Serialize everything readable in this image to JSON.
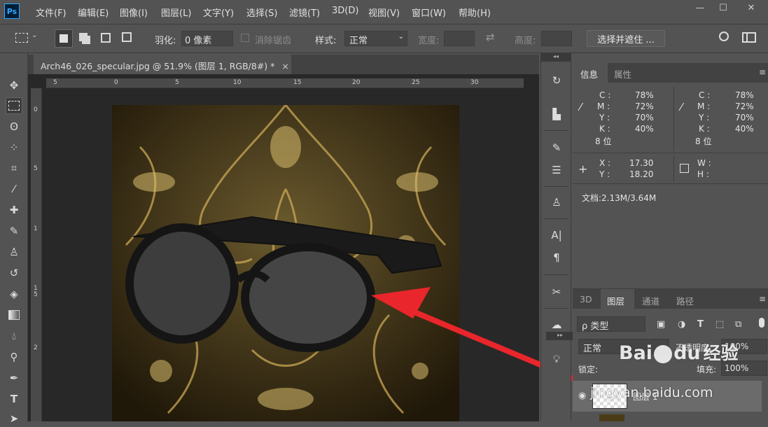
{
  "app": {
    "logo": "Ps"
  },
  "menu": [
    "文件(F)",
    "编辑(E)",
    "图像(I)",
    "图层(L)",
    "文字(Y)",
    "选择(S)",
    "滤镜(T)",
    "3D(D)",
    "视图(V)",
    "窗口(W)",
    "帮助(H)"
  ],
  "window_controls": [
    "—",
    "☐",
    "✕"
  ],
  "options": {
    "feather_label": "羽化:",
    "feather_value": "0 像素",
    "antialias_label": "消除锯齿",
    "style_label": "样式:",
    "style_value": "正常",
    "width_label": "宽度:",
    "height_label": "高度:",
    "select_mask_label": "选择并遮住 ..."
  },
  "document": {
    "tab_title": "Arch46_026_specular.jpg @ 51.9% (图层 1, RGB/8#) *",
    "close": "×",
    "ruler_top_labels": [
      "5",
      "0",
      "5",
      "10",
      "15",
      "20",
      "25",
      "30"
    ],
    "ruler_left_labels": [
      "0",
      "5",
      "1",
      "1\n5",
      "2"
    ]
  },
  "info_panel": {
    "tabs": [
      "信息",
      "属性"
    ],
    "c_label": "C :",
    "c_value": "78%",
    "m_label": "M :",
    "m_value": "72%",
    "y_label": "Y :",
    "y_value": "70%",
    "k_label": "K :",
    "k_value": "40%",
    "bits": "8 位",
    "c2_value": "78%",
    "m2_value": "72%",
    "y2_value": "70%",
    "k2_value": "40%",
    "bits2": "8 位",
    "x_label": "X :",
    "x_value": "17.30",
    "yy_label": "Y :",
    "yy_value": "18.20",
    "w_label": "W :",
    "h_label": "H :",
    "doc_size": "文档:2.13M/3.64M"
  },
  "layers_panel": {
    "tabs": [
      "3D",
      "图层",
      "通道",
      "路径"
    ],
    "filter_kind": "ρ 类型",
    "blend_mode": "正常",
    "opacity_label": "不透明度:",
    "opacity_value": "100%",
    "lock_label": "锁定:",
    "fill_label": "填充:",
    "fill_value": "100%",
    "layer1_name": "图层 1"
  },
  "watermark": {
    "text1": "Bai",
    "text2": "du",
    "text3": "经验",
    "url": "jingyan.baidu.com"
  },
  "colors": {
    "accent_red": "#e8262b",
    "panel_bg": "#535353",
    "canvas_bg": "#282828"
  }
}
